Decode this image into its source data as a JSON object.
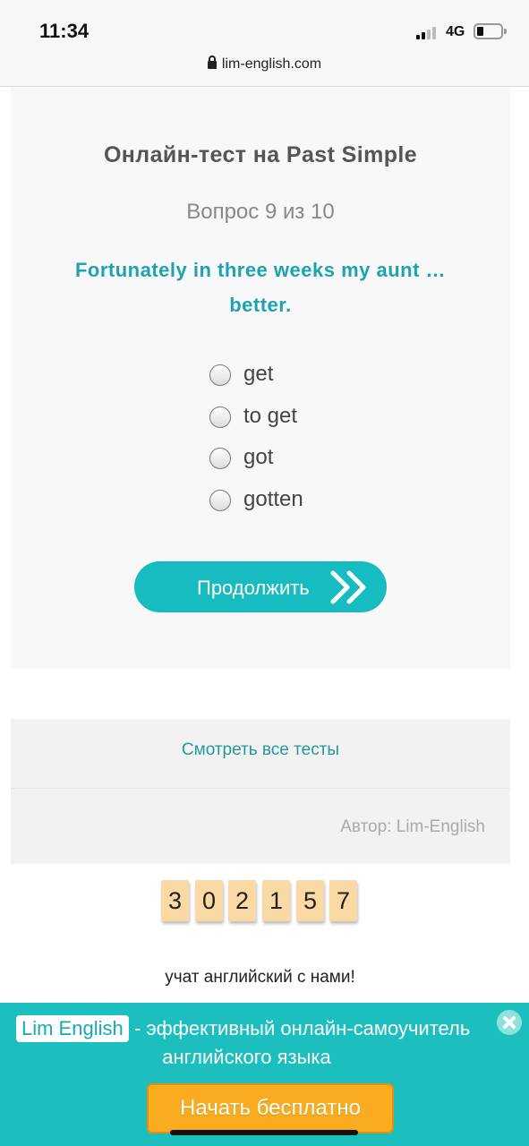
{
  "status_bar": {
    "time": "11:34",
    "network": "4G",
    "signal_bars": 2,
    "battery_level": 0.2
  },
  "browser": {
    "url": "lim-english.com",
    "lock_icon": "lock-icon"
  },
  "quiz": {
    "title": "Онлайн-тест на Past Simple",
    "progress": "Вопрос 9 из 10",
    "question": "Fortunately in three weeks my aunt … better.",
    "options": [
      {
        "label": "get"
      },
      {
        "label": "to get"
      },
      {
        "label": "got"
      },
      {
        "label": "gotten"
      }
    ],
    "continue_label": "Продолжить",
    "continue_icon": "double-chevron-right-icon"
  },
  "tests": {
    "view_all_label": "Смотреть все тесты",
    "author": "Автор: Lim-English"
  },
  "counter": {
    "digits": [
      "3",
      "0",
      "2",
      "1",
      "5",
      "7"
    ],
    "caption": "учат английский с нами!"
  },
  "promo": {
    "brand": "Lim English",
    "line1": "- эффективный онлайн-самоучитель",
    "line2": "английского языка",
    "cta_label": "Начать бесплатно",
    "close_icon": "close-icon"
  },
  "colors": {
    "accent": "#1ba3b1",
    "button": "#17bcc0",
    "promo_bg": "#1cbfbe",
    "cta": "#f9ac1f",
    "counter_tile": "#fbd9a5"
  }
}
